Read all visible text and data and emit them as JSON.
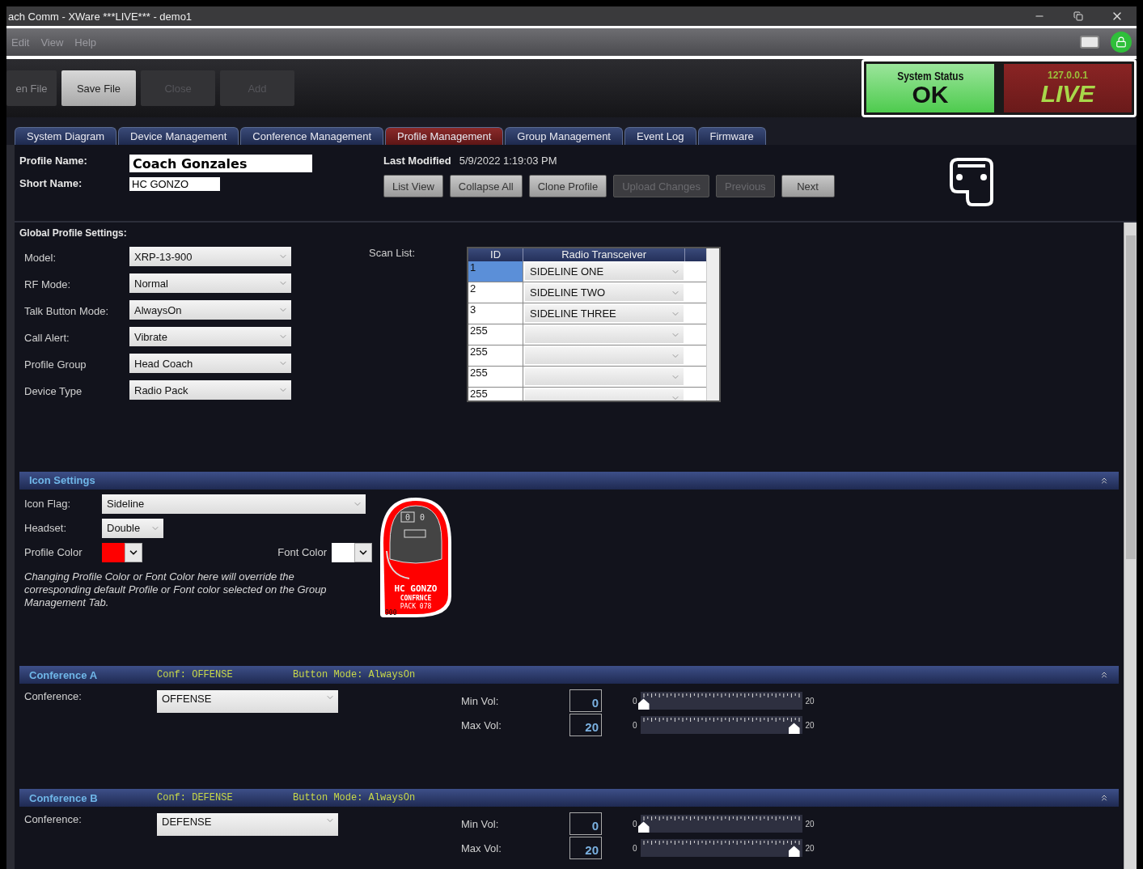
{
  "window": {
    "title": "ach Comm - XWare ***LIVE*** - demo1"
  },
  "menu": [
    {
      "label": "Edit"
    },
    {
      "label": "View"
    },
    {
      "label": "Help"
    }
  ],
  "toolbar": [
    {
      "label": "en File",
      "disabled": false,
      "highlighted": false
    },
    {
      "label": "Save File",
      "disabled": false,
      "highlighted": true
    },
    {
      "label": "Close",
      "disabled": true,
      "highlighted": false
    },
    {
      "label": "Add",
      "disabled": true,
      "highlighted": false
    }
  ],
  "status": {
    "label": "System Status",
    "value": "OK",
    "address": "127.0.0.1",
    "mode": "LIVE"
  },
  "tabs": [
    {
      "label": "System Diagram",
      "selected": false
    },
    {
      "label": "Device Management",
      "selected": false
    },
    {
      "label": "Conference Management",
      "selected": false
    },
    {
      "label": "Profile Management",
      "selected": true
    },
    {
      "label": "Group Management",
      "selected": false
    },
    {
      "label": "Event Log",
      "selected": false
    },
    {
      "label": "Firmware",
      "selected": false
    }
  ],
  "profile": {
    "name_label": "Profile Name:",
    "name": "Coach Gonzales",
    "short_label": "Short Name:",
    "short_name": "HC GONZO",
    "modified_label": "Last Modified",
    "modified": "5/9/2022 1:19:03 PM"
  },
  "actions": [
    {
      "label": "List View",
      "disabled": false
    },
    {
      "label": "Collapse All",
      "disabled": false
    },
    {
      "label": "Clone Profile",
      "disabled": false
    },
    {
      "label": "Upload Changes",
      "disabled": true
    },
    {
      "label": "Previous",
      "disabled": true
    },
    {
      "label": "Next",
      "disabled": false
    }
  ],
  "global": {
    "title": "Global Profile Settings:",
    "fields": [
      {
        "label": "Model:",
        "value": "XRP-13-900"
      },
      {
        "label": "RF Mode:",
        "value": "Normal"
      },
      {
        "label": "Talk Button Mode:",
        "value": "AlwaysOn"
      },
      {
        "label": "Call Alert:",
        "value": "Vibrate"
      },
      {
        "label": "Profile Group",
        "value": "Head Coach"
      },
      {
        "label": "Device Type",
        "value": "Radio Pack"
      }
    ],
    "scan_label": "Scan List:",
    "scan_columns": [
      "ID",
      "Radio Transceiver"
    ],
    "scan_rows": [
      {
        "id": "1",
        "radio": "SIDELINE ONE",
        "selected": true
      },
      {
        "id": "2",
        "radio": "SIDELINE TWO",
        "selected": false
      },
      {
        "id": "3",
        "radio": "SIDELINE THREE",
        "selected": false
      },
      {
        "id": "255",
        "selected": false
      },
      {
        "id": "255",
        "selected": false
      },
      {
        "id": "255",
        "selected": false
      },
      {
        "id": "255",
        "selected": false
      }
    ]
  },
  "icon_settings": {
    "title": "Icon Settings",
    "flag_label": "Icon Flag:",
    "flag": "Sideline",
    "headset_label": "Headset:",
    "headset": "Double",
    "profile_color": {
      "label": "Profile Color",
      "color": "#ff0000"
    },
    "font_color": {
      "label": "Font Color",
      "color": "#ffffff"
    },
    "note": "Changing Profile Color or Font Color here will override the corresponding default Profile or Font color selected on the Group Management Tab.",
    "badge": {
      "counters": [
        "0",
        "0"
      ],
      "line1": "HC GONZO",
      "line2": "CONFRNCE",
      "line3": "PACK 078",
      "number": "900"
    }
  },
  "conferences": [
    {
      "title": "Conference A",
      "conf": "Conf: OFFENSE",
      "mode": "Button Mode: AlwaysOn",
      "label": "Conference:",
      "value": "OFFENSE",
      "volumes": [
        {
          "label": "Min Vol:",
          "reading": "0",
          "min": "0",
          "max": "20",
          "level": 0
        },
        {
          "label": "Max Vol:",
          "reading": "20",
          "min": "0",
          "max": "20",
          "level": 1
        }
      ]
    },
    {
      "title": "Conference B",
      "conf": "Conf: DEFENSE",
      "mode": "Button Mode: AlwaysOn",
      "label": "Conference:",
      "value": "DEFENSE",
      "volumes": [
        {
          "label": "Min Vol:",
          "reading": "0",
          "min": "0",
          "max": "20",
          "level": 0
        },
        {
          "label": "Max Vol:",
          "reading": "20",
          "min": "0",
          "max": "20",
          "level": 1
        }
      ]
    }
  ]
}
